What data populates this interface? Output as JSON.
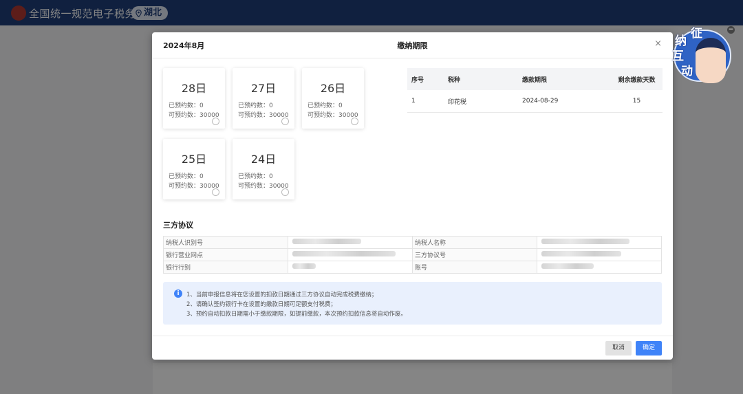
{
  "header": {
    "site_title": "全国统一规范电子税务局",
    "region": "湖北",
    "region_icon": "location-pin-icon"
  },
  "modal": {
    "month": "2024年8月",
    "title": "缴纳期限",
    "close": "×",
    "cards": [
      {
        "day": "28日",
        "booked": "已预约数：0",
        "available": "可预约数：30000"
      },
      {
        "day": "27日",
        "booked": "已预约数：0",
        "available": "可预约数：30000"
      },
      {
        "day": "26日",
        "booked": "已预约数：0",
        "available": "可预约数：30000"
      },
      {
        "day": "25日",
        "booked": "已预约数：0",
        "available": "可预约数：30000"
      },
      {
        "day": "24日",
        "booked": "已预约数：0",
        "available": "可预约数：30000"
      }
    ],
    "due_table": {
      "headers": [
        "序号",
        "税种",
        "缴款期限",
        "剩余缴款天数"
      ],
      "rows": [
        [
          "1",
          "印花税",
          "2024-08-29",
          "15"
        ]
      ]
    },
    "section_title": "三方协议",
    "agreement": {
      "taxpayer_id_label": "纳税人识别号",
      "taxpayer_name_label": "纳税人名称",
      "bank_branch_label": "银行营业网点",
      "agreement_no_label": "三方协议号",
      "bank_category_label": "银行行别",
      "account_label": "账号"
    },
    "notice": {
      "icon": "info-icon",
      "lines": [
        "1、当前申报信息将在您设置的扣款日期通过三方协议自动完成税费缴纳；",
        "2、请确认签约银行卡在设置的缴款日期可足额支付税费；",
        "3、预约自动扣款日期需小于缴款期限，如提前缴款，本次预约扣款信息将自动作废。"
      ]
    },
    "buttons": {
      "cancel": "取消",
      "confirm": "确定"
    }
  },
  "widget": {
    "chars": [
      "征",
      "纳",
      "互",
      "动"
    ],
    "minimize": "−"
  }
}
